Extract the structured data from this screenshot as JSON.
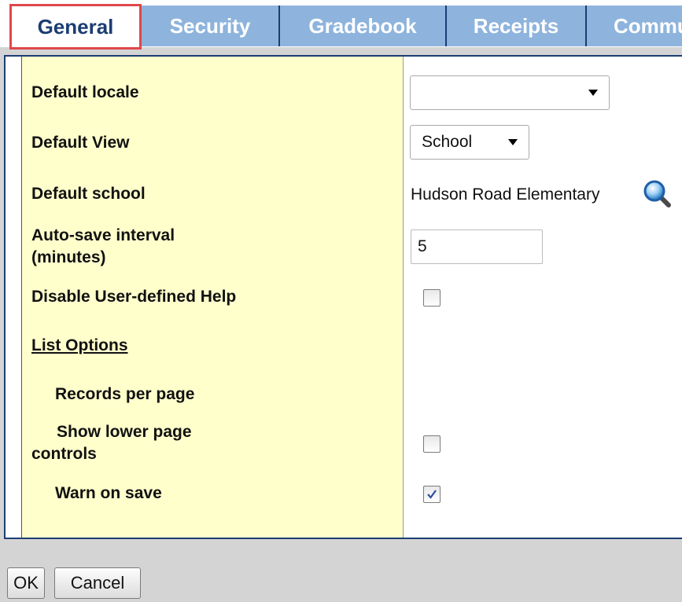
{
  "tabs": [
    {
      "label": "General",
      "active": true
    },
    {
      "label": "Security",
      "active": false
    },
    {
      "label": "Gradebook",
      "active": false
    },
    {
      "label": "Receipts",
      "active": false
    },
    {
      "label": "Commu",
      "active": false
    }
  ],
  "fields": {
    "default_locale": {
      "label": "Default locale",
      "value": ""
    },
    "default_view": {
      "label": "Default View",
      "value": "School"
    },
    "default_school": {
      "label": "Default school",
      "value": "Hudson Road Elementary",
      "icon": "magnifier-icon"
    },
    "autosave": {
      "label_line1": "Auto-save interval",
      "label_line2": "(minutes)",
      "value": "5"
    },
    "disable_help": {
      "label": "Disable User-defined Help",
      "checked": false
    },
    "list_options": {
      "label": "List Options"
    },
    "records_per_page": {
      "label": "Records per page"
    },
    "show_lower_controls": {
      "label_line1": "Show lower page",
      "label_line2": "controls",
      "checked": false
    },
    "warn_on_save": {
      "label": "Warn on save",
      "checked": true
    }
  },
  "buttons": {
    "ok": "OK",
    "cancel": "Cancel"
  },
  "colors": {
    "tab_blue": "#8eb4dd",
    "active_border": "#e0474c",
    "label_bg": "#ffffcc",
    "frame": "#1c3d73"
  }
}
